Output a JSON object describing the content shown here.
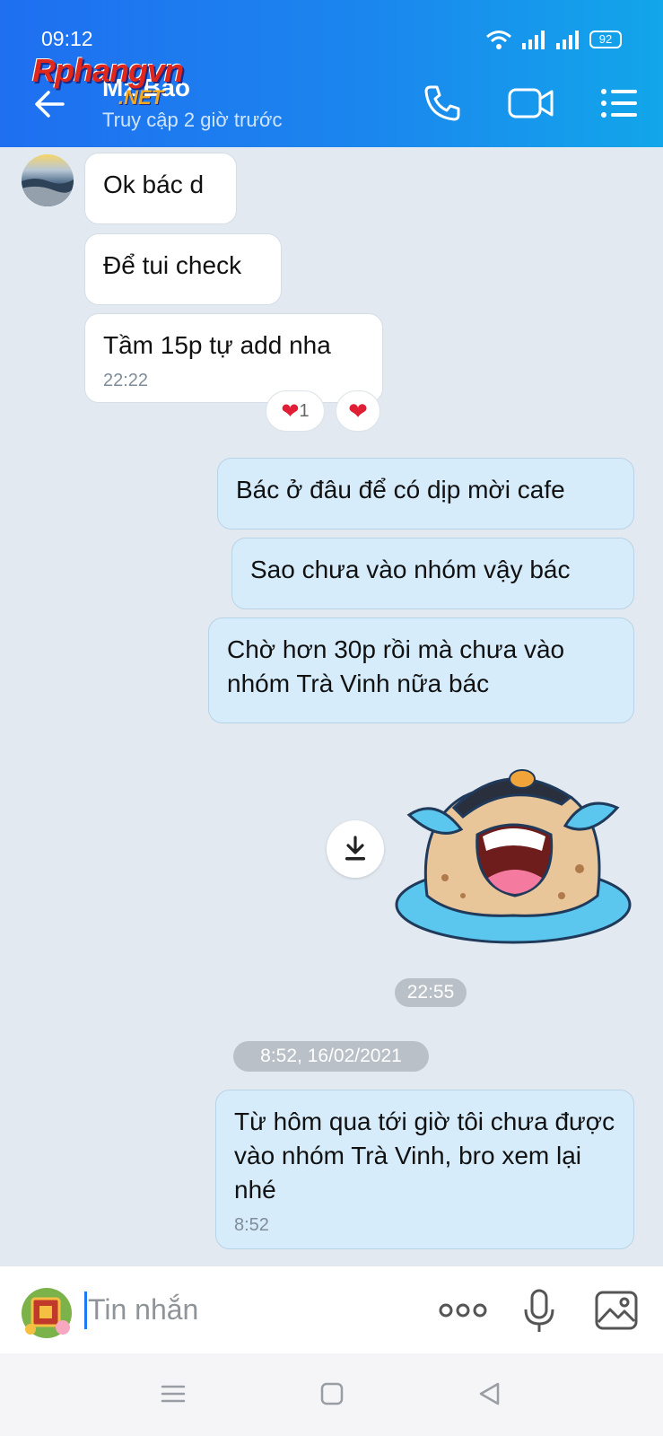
{
  "status_bar": {
    "time": "09:12",
    "battery": "92"
  },
  "watermark": {
    "main": "Rphangvn",
    "net": ".NET"
  },
  "header": {
    "contact_name": "Mz Bao",
    "last_seen": "Truy cập 2 giờ trước"
  },
  "messages": {
    "incoming": [
      {
        "text": "Ok bác d"
      },
      {
        "text": "Để tui check"
      },
      {
        "text": "Tầm 15p tự add nha",
        "time": "22:22"
      }
    ],
    "reaction_count": "1",
    "outgoing": [
      {
        "text": "Bác ở đâu để có dịp mời cafe"
      },
      {
        "text": "Sao chưa vào nhóm vậy bác"
      },
      {
        "text": "Chờ hơn 30p rồi mà chưa vào nhóm Trà Vinh nữa bác"
      }
    ],
    "sticker_time": "22:55",
    "date_separator": "8:52, 16/02/2021",
    "last": {
      "text": "Từ hôm qua tới giờ tôi chưa được vào nhóm Trà Vinh, bro xem lại nhé",
      "time": "8:52"
    }
  },
  "input_bar": {
    "placeholder": "Tin nhắn"
  },
  "icons": {
    "back": "arrow-left-icon",
    "call": "phone-icon",
    "video": "video-camera-icon",
    "menu": "list-menu-icon",
    "download": "download-icon",
    "more": "more-dots-icon",
    "mic": "microphone-icon",
    "image": "image-icon"
  },
  "colors": {
    "header_start": "#1f6ff0",
    "header_end": "#12a6ea",
    "outgoing_bubble": "#d6ecfb",
    "background": "#e2e9f1"
  }
}
